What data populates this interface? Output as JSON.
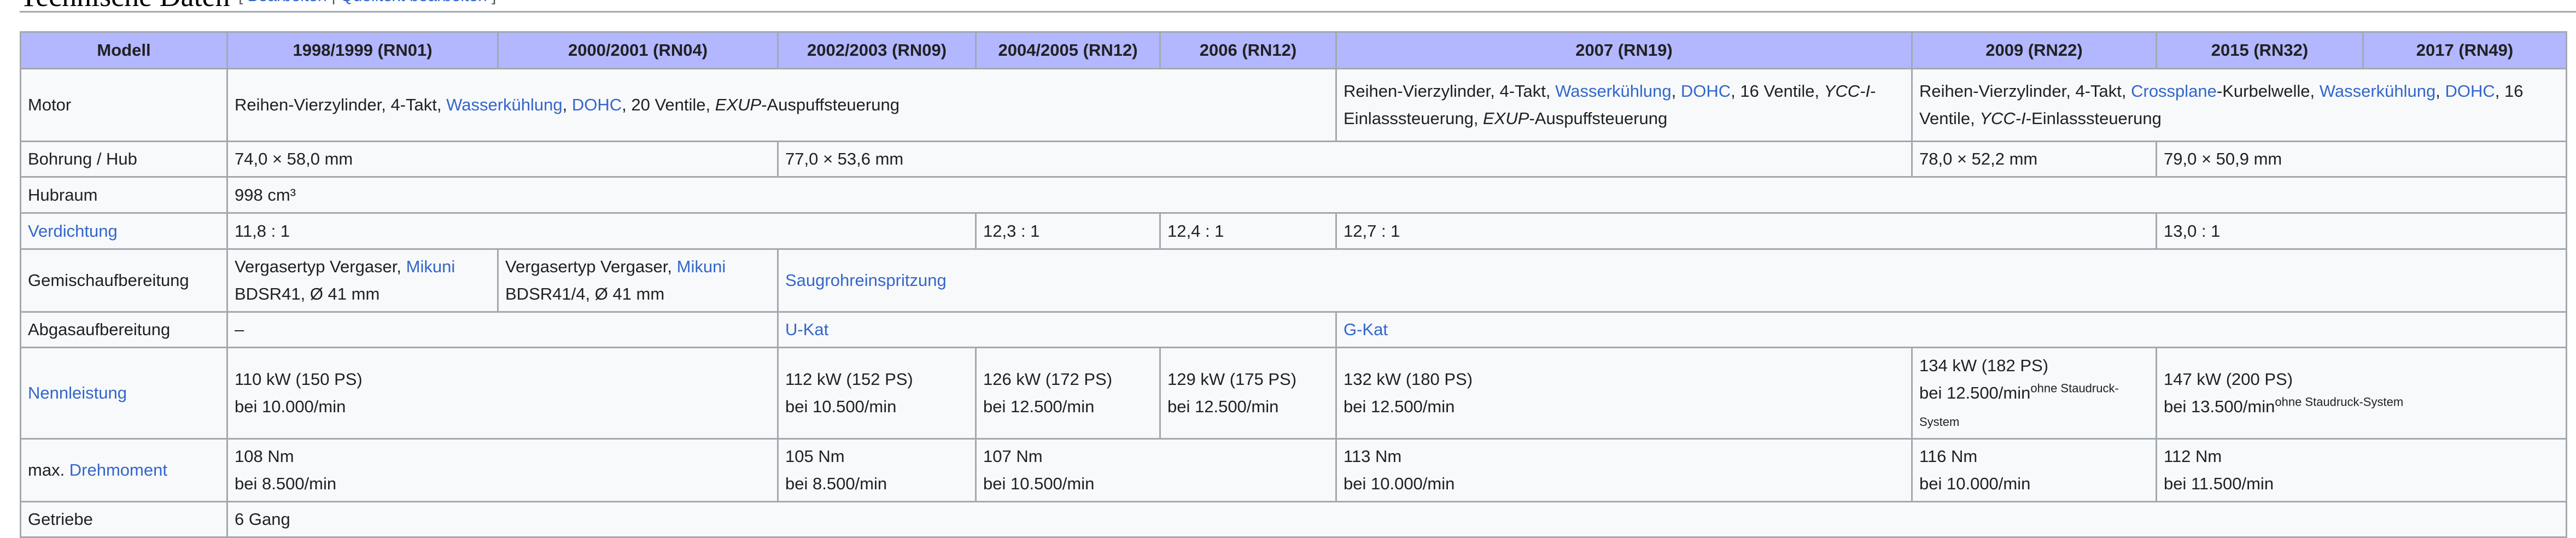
{
  "heading": {
    "title": "Technische Daten",
    "edit": "Bearbeiten",
    "edit_source": "Quelltext bearbeiten"
  },
  "columns": [
    "Modell",
    "1998/1999 (RN01)",
    "2000/2001 (RN04)",
    "2002/2003 (RN09)",
    "2004/2005 (RN12)",
    "2006 (RN12)",
    "2007 (RN19)",
    "2009 (RN22)",
    "2015 (RN32)",
    "2017 (RN49)"
  ],
  "motor": {
    "label": "Motor",
    "a": {
      "t1": "Reihen-Vierzylinder, 4-Takt, ",
      "l1": "Wasserkühlung",
      "t2": ", ",
      "l2": "DOHC",
      "t3": ", 20 Ventile, ",
      "i1": "EXUP",
      "t4": "-Auspuffsteuerung"
    },
    "b": {
      "t1": "Reihen-Vierzylinder, 4-Takt, ",
      "l1": "Wasserkühlung",
      "t2": ", ",
      "l2": "DOHC",
      "t3": ", 16 Ventile, ",
      "i1": "YCC-I",
      "t4": "-Einlasssteuerung, ",
      "i2": "EXUP",
      "t5": "-Auspuffsteuerung"
    },
    "c": {
      "t1": "Reihen-Vierzylinder, 4-Takt, ",
      "l1": "Crossplane",
      "t2": "-Kurbelwelle, ",
      "l2": "Wasserkühlung",
      "t3": ", ",
      "l3": "DOHC",
      "t4": ", 16 Ventile, ",
      "i1": "YCC-I",
      "t5": "-Einlasssteuerung"
    }
  },
  "bohrung": {
    "label": "Bohrung / Hub",
    "v1": "74,0 × 58,0 mm",
    "v2": "77,0 × 53,6 mm",
    "v3": "78,0 × 52,2 mm",
    "v4": "79,0 × 50,9 mm"
  },
  "hubraum": {
    "label": "Hubraum",
    "v1": "998 cm³"
  },
  "verdichtung": {
    "label": "Verdichtung",
    "v1": "11,8 : 1",
    "v2": "12,3 : 1",
    "v3": "12,4 : 1",
    "v4": "12,7 : 1",
    "v5": "13,0 : 1"
  },
  "gemisch": {
    "label": "Gemischaufbereitung",
    "a": {
      "t1": "Vergasertyp Vergaser, ",
      "l1": "Mikuni",
      "t2": "BDSR41, Ø 41 mm"
    },
    "b": {
      "t1": "Vergasertyp Vergaser, ",
      "l1": "Mikuni",
      "t2": "BDSR41/4, Ø 41 mm"
    },
    "c": "Saugrohreinspritzung"
  },
  "abgas": {
    "label": "Abgasaufbereitung",
    "v1": "–",
    "v2": "U-Kat",
    "v3": "G-Kat"
  },
  "nennleistung": {
    "label": "Nennleistung",
    "c1": {
      "l1": "110 kW (150 PS)",
      "l2": "bei 10.000/min"
    },
    "c2": {
      "l1": "112 kW (152 PS)",
      "l2": "bei 10.500/min"
    },
    "c3": {
      "l1": "126 kW (172 PS)",
      "l2": "bei 12.500/min"
    },
    "c4": {
      "l1": "129 kW (175 PS)",
      "l2": "bei 12.500/min"
    },
    "c5": {
      "l1": "132 kW (180 PS)",
      "l2": "bei 12.500/min"
    },
    "c6": {
      "l1": "134 kW (182 PS)",
      "l2": "bei 12.500/min",
      "sup": "ohne Staudruck-",
      "l3": "System"
    },
    "c7": {
      "l1": "147 kW (200 PS)",
      "l2": "bei 13.500/min",
      "sup": "ohne Staudruck-System"
    }
  },
  "drehmoment": {
    "label_prefix": "max. ",
    "label_link": "Drehmoment",
    "c1": {
      "l1": "108 Nm",
      "l2": "bei 8.500/min"
    },
    "c2": {
      "l1": "105 Nm",
      "l2": "bei 8.500/min"
    },
    "c3": {
      "l1": "107 Nm",
      "l2": "bei 10.500/min"
    },
    "c4": {
      "l1": "113 Nm",
      "l2": "bei 10.000/min"
    },
    "c5": {
      "l1": "116 Nm",
      "l2": "bei 10.000/min"
    },
    "c6": {
      "l1": "112 Nm",
      "l2": "bei 11.500/min"
    }
  },
  "getriebe": {
    "label": "Getriebe",
    "v1": "6 Gang"
  },
  "colors": {
    "header_bg": "#b3b7ff",
    "link": "#3366cc",
    "border": "#a2a9b1",
    "cell_bg": "#f8f9fa"
  }
}
